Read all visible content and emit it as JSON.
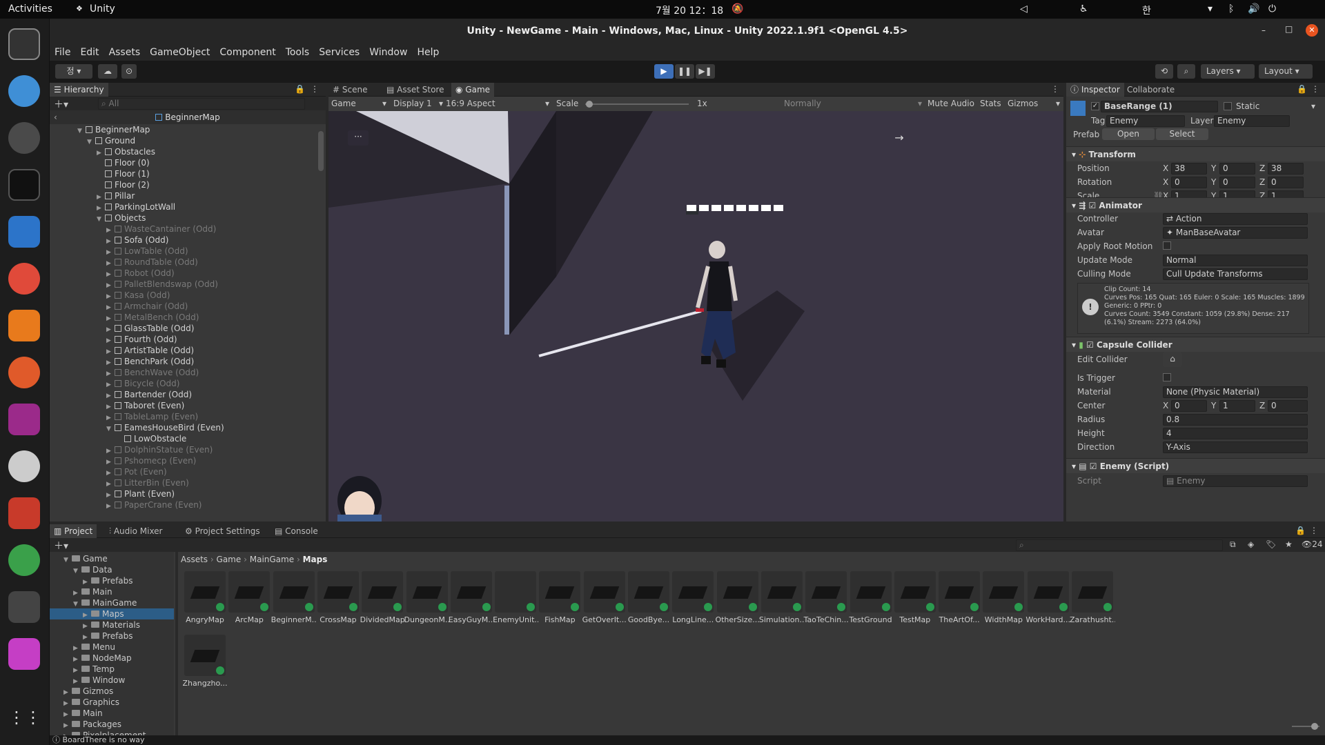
{
  "topbar": {
    "activities": "Activities",
    "app": "Unity",
    "clock": "7월 20 12：18",
    "ime": "한"
  },
  "window": {
    "title": "Unity - NewGame - Main - Windows, Mac, Linux - Unity 2022.1.9f1 <OpenGL 4.5>"
  },
  "menu": [
    "File",
    "Edit",
    "Assets",
    "GameObject",
    "Component",
    "Tools",
    "Services",
    "Window",
    "Help"
  ],
  "toolbar": {
    "account": "정",
    "layers": "Layers",
    "layout": "Layout"
  },
  "hierarchy": {
    "tab": "Hierarchy",
    "search": "All",
    "scene": "BeginnerMap",
    "rows": [
      {
        "t": "BeginnerMap",
        "d": 1,
        "on": 1
      },
      {
        "t": "Ground",
        "d": 2,
        "on": 1
      },
      {
        "t": "Obstacles",
        "d": 3,
        "on": 1
      },
      {
        "t": "Floor (0)",
        "d": 3,
        "on": 1
      },
      {
        "t": "Floor (1)",
        "d": 3,
        "on": 1
      },
      {
        "t": "Floor (2)",
        "d": 3,
        "on": 1
      },
      {
        "t": "Pillar",
        "d": 3,
        "on": 1
      },
      {
        "t": "ParkingLotWall",
        "d": 3,
        "on": 1
      },
      {
        "t": "Objects",
        "d": 3,
        "on": 1
      },
      {
        "t": "WasteCantainer (Odd)",
        "d": 4,
        "on": 0
      },
      {
        "t": "Sofa (Odd)",
        "d": 4,
        "on": 1
      },
      {
        "t": "LowTable (Odd)",
        "d": 4,
        "on": 0
      },
      {
        "t": "RoundTable (Odd)",
        "d": 4,
        "on": 0
      },
      {
        "t": "Robot (Odd)",
        "d": 4,
        "on": 0
      },
      {
        "t": "PalletBlendswap (Odd)",
        "d": 4,
        "on": 0
      },
      {
        "t": "Kasa (Odd)",
        "d": 4,
        "on": 0
      },
      {
        "t": "Armchair (Odd)",
        "d": 4,
        "on": 0
      },
      {
        "t": "MetalBench (Odd)",
        "d": 4,
        "on": 0
      },
      {
        "t": "GlassTable (Odd)",
        "d": 4,
        "on": 1
      },
      {
        "t": "Fourth (Odd)",
        "d": 4,
        "on": 1
      },
      {
        "t": "ArtistTable (Odd)",
        "d": 4,
        "on": 1
      },
      {
        "t": "BenchPark (Odd)",
        "d": 4,
        "on": 1
      },
      {
        "t": "BenchWave (Odd)",
        "d": 4,
        "on": 0
      },
      {
        "t": "Bicycle (Odd)",
        "d": 4,
        "on": 0
      },
      {
        "t": "Bartender (Odd)",
        "d": 4,
        "on": 1
      },
      {
        "t": "Taboret (Even)",
        "d": 4,
        "on": 1
      },
      {
        "t": "TableLamp (Even)",
        "d": 4,
        "on": 0
      },
      {
        "t": "EamesHouseBird (Even)",
        "d": 4,
        "on": 1
      },
      {
        "t": "LowObstacle",
        "d": 5,
        "on": 1
      },
      {
        "t": "DolphinStatue (Even)",
        "d": 4,
        "on": 0
      },
      {
        "t": "Pshomecp (Even)",
        "d": 4,
        "on": 0
      },
      {
        "t": "Pot (Even)",
        "d": 4,
        "on": 0
      },
      {
        "t": "LitterBin (Even)",
        "d": 4,
        "on": 0
      },
      {
        "t": "Plant (Even)",
        "d": 4,
        "on": 1
      },
      {
        "t": "PaperCrane (Even)",
        "d": 4,
        "on": 0
      }
    ]
  },
  "game": {
    "tabs": [
      "Scene",
      "Asset Store",
      "Game"
    ],
    "mode": "Game",
    "display": "Display 1",
    "aspect": "16:9 Aspect",
    "scale_label": "Scale",
    "scale_value": "1x",
    "normally": "Normally",
    "mute": "Mute Audio",
    "stats": "Stats",
    "gizmos": "Gizmos",
    "dots": "···",
    "arrow": "→"
  },
  "inspector": {
    "tabs": [
      "Inspector",
      "Collaborate"
    ],
    "name": "BaseRange (1)",
    "static": "Static",
    "tag_label": "Tag",
    "tag": "Enemy",
    "layer_label": "Layer",
    "layer": "Enemy",
    "prefab_label": "Prefab",
    "open": "Open",
    "select": "Select",
    "transform": {
      "title": "Transform",
      "rows": [
        {
          "l": "Position",
          "x": "38",
          "y": "0",
          "z": "38"
        },
        {
          "l": "Rotation",
          "x": "0",
          "y": "0",
          "z": "0"
        },
        {
          "l": "Scale",
          "x": "1",
          "y": "1",
          "z": "1"
        }
      ]
    },
    "animator": {
      "title": "Animator",
      "controller_label": "Controller",
      "controller": "Action",
      "avatar_label": "Avatar",
      "avatar": "ManBaseAvatar",
      "root_label": "Apply Root Motion",
      "update_label": "Update Mode",
      "update": "Normal",
      "culling_label": "Culling Mode",
      "culling": "Cull Update Transforms",
      "info": [
        "Clip Count: 14",
        "Curves Pos: 165 Quat: 165 Euler: 0 Scale: 165 Muscles: 1899",
        "Generic: 0 PPtr: 0",
        "Curves Count: 3549 Constant: 1059 (29.8%) Dense: 217",
        "(6.1%) Stream: 2273 (64.0%)"
      ]
    },
    "capsule": {
      "title": "Capsule Collider",
      "edit_label": "Edit Collider",
      "trigger_label": "Is Trigger",
      "material_label": "Material",
      "material": "None (Physic Material)",
      "center_label": "Center",
      "cx": "0",
      "cy": "1",
      "cz": "0",
      "radius_label": "Radius",
      "radius": "0.8",
      "height_label": "Height",
      "height": "4",
      "direction_label": "Direction",
      "direction": "Y-Axis"
    },
    "enemy": {
      "title": "Enemy (Script)",
      "script_label": "Script",
      "script": "Enemy"
    }
  },
  "project": {
    "tabs": [
      "Project",
      "Audio Mixer",
      "Project Settings",
      "Console"
    ],
    "breadcrumb": [
      "Assets",
      "Game",
      "MainGame",
      "Maps"
    ],
    "count": "24",
    "tree": [
      {
        "t": "Game",
        "d": 1
      },
      {
        "t": "Data",
        "d": 2
      },
      {
        "t": "Prefabs",
        "d": 3
      },
      {
        "t": "Main",
        "d": 2
      },
      {
        "t": "MainGame",
        "d": 2
      },
      {
        "t": "Maps",
        "d": 3,
        "sel": 1
      },
      {
        "t": "Materials",
        "d": 3
      },
      {
        "t": "Prefabs",
        "d": 3
      },
      {
        "t": "Menu",
        "d": 2
      },
      {
        "t": "NodeMap",
        "d": 2
      },
      {
        "t": "Temp",
        "d": 2
      },
      {
        "t": "Window",
        "d": 2
      },
      {
        "t": "Gizmos",
        "d": 1
      },
      {
        "t": "Graphics",
        "d": 1
      },
      {
        "t": "Main",
        "d": 1
      },
      {
        "t": "Packages",
        "d": 1
      },
      {
        "t": "Pixelplacement",
        "d": 1
      }
    ],
    "assets": [
      "AngryMap",
      "ArcMap",
      "BeginnerM...",
      "CrossMap",
      "DividedMap",
      "DungeonM...",
      "EasyGuyM...",
      "EnemyUnit...",
      "FishMap",
      "GetOverIt...",
      "GoodBye...",
      "LongLine...",
      "OtherSize...",
      "Simulation...",
      "TaoTeChin...",
      "TestGround",
      "TestMap",
      "TheArtOf...",
      "WidthMap",
      "WorkHard...",
      "Zarathusht...",
      "Zhangzho..."
    ]
  },
  "status": {
    "text": "BoardThere is no way"
  }
}
